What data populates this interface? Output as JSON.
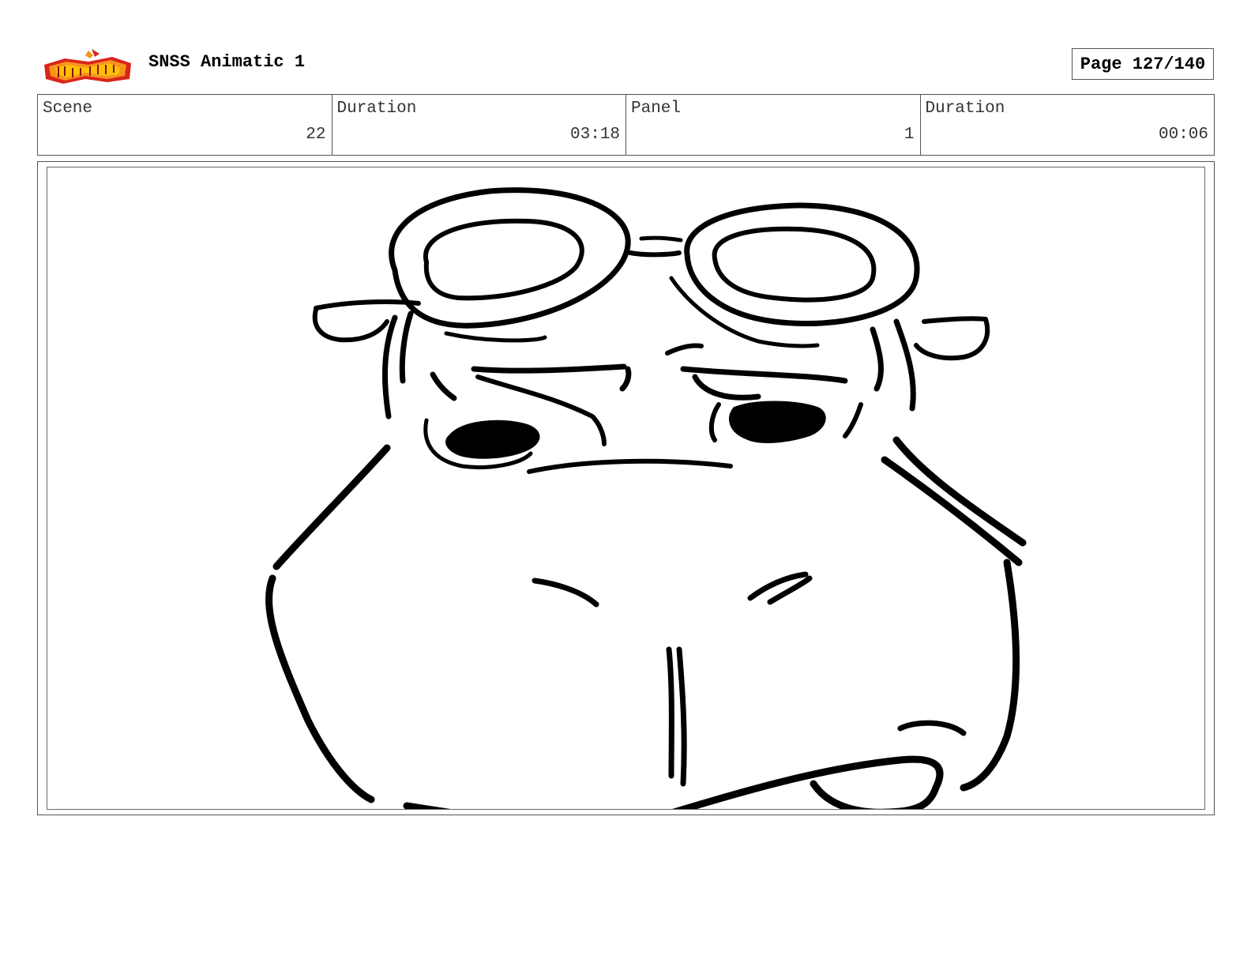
{
  "header": {
    "logo_name": "show-logo",
    "title": "SNSS Animatic 1",
    "page": "Page 127/140"
  },
  "info": {
    "scene_label": "Scene",
    "scene_value": "22",
    "scene_duration_label": "Duration",
    "scene_duration_value": "03:18",
    "panel_label": "Panel",
    "panel_value": "1",
    "panel_duration_label": "Duration",
    "panel_duration_value": "00:06"
  },
  "colors": {
    "logo_red": "#d9251b",
    "logo_orange": "#f7941d",
    "logo_yellow": "#ffd200",
    "ink": "#000000"
  }
}
